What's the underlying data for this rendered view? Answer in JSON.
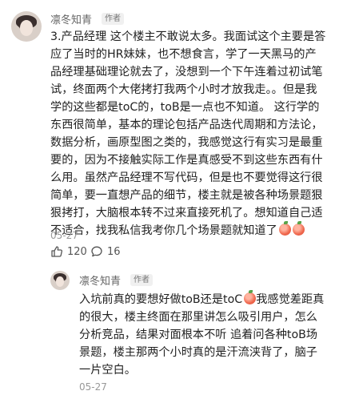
{
  "comment": {
    "author": "凛冬知青",
    "author_tag": "作者",
    "lines": [
      "3.产品经理 这个楼主不敢说太多。我面试这个主要是答",
      "应了当时的HR妹妹，也不想食言，学了一天黑马的产",
      "品经理基础理论就去了，没想到一个下午连着过初试笔",
      "试，终面两个大佬拷打我两个小时才放我走。。但是我",
      "学的这些都是toC的，toB是一点也不知道。 这行学的",
      "东西很简单，基本的理论包括产品迭代周期和方法论，",
      "数据分析，画原型图之类的，我感觉这行有实习是最重",
      "要的，因为不接触实际工作是真感受不到这些东西有什",
      "么用。虽然产品经理不写代码，但是也不要觉得这行很",
      "简单，要一直想产品的细节，楼主就是被各种场景题狠",
      "狠拷打，大脑根本转不过来直接死机了。想知道自己适",
      "不适合，找我私信我考你几个场景题就知道了"
    ],
    "date": "05-27",
    "like_count": "120",
    "reply_count": "16"
  },
  "reply": {
    "author": "凛冬知青",
    "author_tag": "作者",
    "lines": [
      "入坑前真的要想好做toB还是toC",
      "的很大，楼主终面在那里讲怎么吸引用户，怎么",
      "分析竞品，结果对面根本不听 追着问各种toB场",
      "景题，楼主那两个小时真的是汗流浃背了，脑子",
      "一片空白。"
    ],
    "first_line_tail": "我感觉差距真",
    "date": "05-27"
  },
  "icons": {
    "like": "thumbs-up-icon",
    "reply": "comment-bubble-icon",
    "emoji": "peach-emoji-icon"
  }
}
